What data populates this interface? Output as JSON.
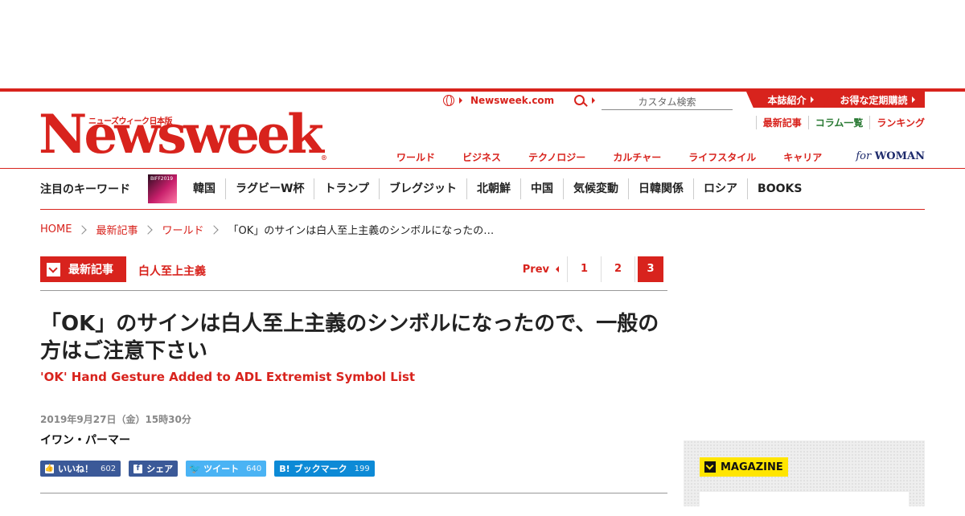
{
  "header": {
    "logo_subtitle": "ニューズウィーク日本版",
    "logo": "Newsweek",
    "logo_reg": "®",
    "site_link": "Newsweek.com",
    "search_placeholder": "カスタム検索",
    "top_buttons": [
      "本誌紹介",
      "お得な定期購読"
    ],
    "sub_links": [
      "最新記事",
      "コラム一覧",
      "ランキング"
    ],
    "nav": [
      "ワールド",
      "ビジネス",
      "テクノロジー",
      "カルチャー",
      "ライフスタイル",
      "キャリア"
    ],
    "for_woman_prefix": "for",
    "for_woman": "WOMAN"
  },
  "keywords": {
    "label": "注目のキーワード",
    "thumb_text": "BIFF2019",
    "items": [
      "韓国",
      "ラグビーW杯",
      "トランプ",
      "ブレグジット",
      "北朝鮮",
      "中国",
      "気候変動",
      "日韓関係",
      "ロシア",
      "BOOKS"
    ]
  },
  "breadcrumb": [
    "HOME",
    "最新記事",
    "ワールド",
    "「OK」のサインは白人至上主義のシンボルになったの…"
  ],
  "section": {
    "badge": "最新記事",
    "tag": "白人至上主義",
    "pager": {
      "prev": "Prev",
      "pages": [
        "1",
        "2",
        "3"
      ],
      "current": "3"
    }
  },
  "article": {
    "title": "「OK」のサインは白人至上主義のシンボルになったので、一般の方はご注意下さい",
    "subtitle": "'OK' Hand Gesture Added to ADL Extremist Symbol List",
    "date": "2019年9月27日（金）15時30分",
    "author": "イワン・パーマー"
  },
  "social": {
    "like": {
      "label": "いいね！",
      "count": "602"
    },
    "share": {
      "label": "シェア"
    },
    "tweet": {
      "label": "ツイート",
      "count": "640"
    },
    "bookmark": {
      "label": "ブックマーク",
      "count": "199"
    }
  },
  "sidebar": {
    "badge": "MAGAZINE"
  },
  "colors": {
    "brand_red": "#d8231d",
    "facebook": "#3b5998",
    "twitter": "#4ab3f4",
    "hatena": "#0d8ad6",
    "magazine_yellow": "#ffe500"
  }
}
